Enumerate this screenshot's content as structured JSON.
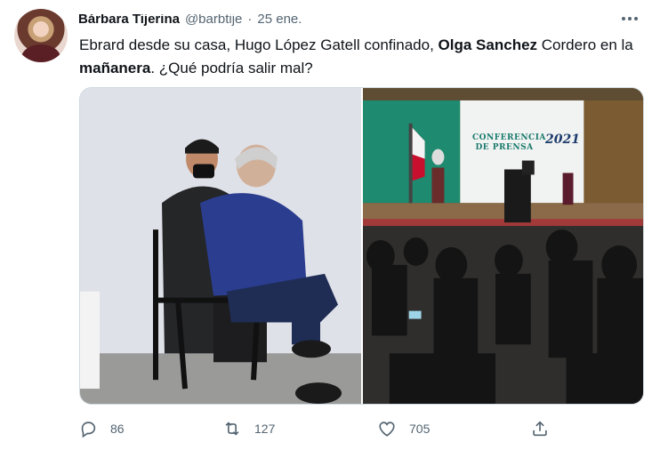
{
  "tweet": {
    "author_name": "Bárbara Tijerina",
    "handle": "@barbtije",
    "separator": "·",
    "time": "25 ene.",
    "text_parts": [
      {
        "t": "Ebrard desde su casa, Hugo López Gatell confinado, ",
        "bold": false
      },
      {
        "t": "Olga Sanchez",
        "bold": true
      },
      {
        "t": " Cordero en la ",
        "bold": false
      },
      {
        "t": "mañanera",
        "bold": true
      },
      {
        "t": ". ¿Qué podría salir mal?",
        "bold": false
      }
    ]
  },
  "media": {
    "banner_line1": "CONFERENCIA DE PRENSA",
    "banner_line2": "2021"
  },
  "actions": {
    "reply_count": "86",
    "retweet_count": "127",
    "like_count": "705"
  },
  "icons": [
    "more-icon",
    "reply-icon",
    "retweet-icon",
    "like-icon",
    "share-icon"
  ]
}
